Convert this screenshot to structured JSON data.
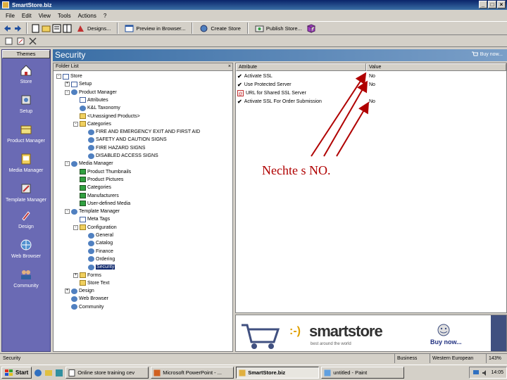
{
  "window": {
    "title": "SmartStore.biz",
    "controls": [
      "_",
      "□",
      "×"
    ]
  },
  "menu": [
    "File",
    "Edit",
    "View",
    "Tools",
    "Actions",
    "?"
  ],
  "toolbar": {
    "buttons": [
      "Designs...",
      "Preview in Browser...",
      "Create Store",
      "Publish Store..."
    ]
  },
  "sidebar": {
    "header": "Themes",
    "items": [
      "Store",
      "Setup",
      "Product Manager",
      "Media Manager",
      "Template Manager",
      "Design",
      "Web Browser",
      "Community"
    ]
  },
  "section": {
    "title": "Security",
    "buy_now": "Buy now..."
  },
  "tree": {
    "header": "Folder List",
    "close": "×",
    "nodes": [
      {
        "label": "Store",
        "depth": 0,
        "toggle": "-",
        "icon": "page"
      },
      {
        "label": "Setup",
        "depth": 1,
        "toggle": "+",
        "icon": "page"
      },
      {
        "label": "Product Manager",
        "depth": 1,
        "toggle": "-",
        "icon": "gear"
      },
      {
        "label": "Attributes",
        "depth": 2,
        "toggle": "",
        "icon": "page"
      },
      {
        "label": "K&L Taxonomy",
        "depth": 2,
        "toggle": "",
        "icon": "gear"
      },
      {
        "label": "<Unassigned Products>",
        "depth": 2,
        "toggle": "",
        "icon": "folder"
      },
      {
        "label": "Categories",
        "depth": 2,
        "toggle": "-",
        "icon": "folder"
      },
      {
        "label": "FIRE AND EMERGENCY EXIT AND FIRST AID",
        "depth": 3,
        "toggle": "",
        "icon": "gear"
      },
      {
        "label": "SAFETY AND CAUTION SIGNS",
        "depth": 3,
        "toggle": "",
        "icon": "gear"
      },
      {
        "label": "FIRE HAZARD SIGNS",
        "depth": 3,
        "toggle": "",
        "icon": "gear"
      },
      {
        "label": "DISABLED ACCESS SIGNS",
        "depth": 3,
        "toggle": "",
        "icon": "gear"
      },
      {
        "label": "Media Manager",
        "depth": 1,
        "toggle": "-",
        "icon": "gear"
      },
      {
        "label": "Product Thumbnails",
        "depth": 2,
        "toggle": "",
        "icon": "img"
      },
      {
        "label": "Product Pictures",
        "depth": 2,
        "toggle": "",
        "icon": "img"
      },
      {
        "label": "Categories",
        "depth": 2,
        "toggle": "",
        "icon": "img"
      },
      {
        "label": "Manufacturers",
        "depth": 2,
        "toggle": "",
        "icon": "img"
      },
      {
        "label": "User-defined Media",
        "depth": 2,
        "toggle": "",
        "icon": "img"
      },
      {
        "label": "Template Manager",
        "depth": 1,
        "toggle": "-",
        "icon": "gear"
      },
      {
        "label": "Meta Tags",
        "depth": 2,
        "toggle": "",
        "icon": "page"
      },
      {
        "label": "Configuration",
        "depth": 2,
        "toggle": "-",
        "icon": "folder"
      },
      {
        "label": "General",
        "depth": 3,
        "toggle": "",
        "icon": "gear"
      },
      {
        "label": "Catalog",
        "depth": 3,
        "toggle": "",
        "icon": "gear"
      },
      {
        "label": "Finance",
        "depth": 3,
        "toggle": "",
        "icon": "gear"
      },
      {
        "label": "Ordering",
        "depth": 3,
        "toggle": "",
        "icon": "gear"
      },
      {
        "label": "Security",
        "depth": 3,
        "toggle": "",
        "icon": "gear",
        "selected": true
      },
      {
        "label": "Forms",
        "depth": 2,
        "toggle": "+",
        "icon": "folder"
      },
      {
        "label": "Store Text",
        "depth": 2,
        "toggle": "",
        "icon": "folder"
      },
      {
        "label": "Design",
        "depth": 1,
        "toggle": "+",
        "icon": "gear"
      },
      {
        "label": "Web Browser",
        "depth": 1,
        "toggle": "",
        "icon": "gear"
      },
      {
        "label": "Community",
        "depth": 1,
        "toggle": "",
        "icon": "gear"
      }
    ]
  },
  "attributes": {
    "headers": {
      "attribute": "Attribute",
      "value": "Value"
    },
    "rows": [
      {
        "name": "Activate SSL",
        "value": "No",
        "icon": "check"
      },
      {
        "name": "Use Protected Server",
        "value": "No",
        "icon": "check"
      },
      {
        "name": "URL for Shared SSL Server",
        "value": "",
        "icon": "url"
      },
      {
        "name": "Activate SSL For Order Submission",
        "value": "No",
        "icon": "check"
      }
    ]
  },
  "annotation": "Nechte s NO.",
  "banner": {
    "brand_mark": ":-)",
    "brand": "smartstore",
    "tagline": "best around the world",
    "buy_now": "Buy now..."
  },
  "status": {
    "text": "Security",
    "lang1": "Business",
    "lang2": "Western European",
    "zoom": "143%"
  },
  "taskbar": {
    "start": "Start",
    "tasks": [
      "Online store training cev",
      "Microsoft PowerPoint - ...",
      "SmartStore.biz",
      "untitled - Paint"
    ],
    "active_task": 2,
    "clock": "14:05"
  },
  "colors": {
    "sidebar": "#6a6ab4",
    "titlebar": "#0a246a",
    "annotation": "#b00000",
    "selection": "#0a246a"
  }
}
